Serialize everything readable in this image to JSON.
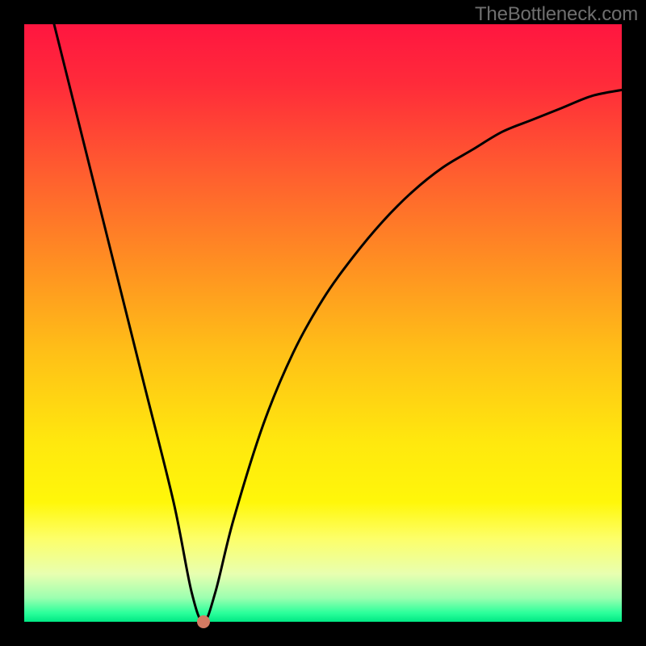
{
  "watermark": "TheBottleneck.com",
  "chart_data": {
    "type": "line",
    "title": "",
    "xlabel": "",
    "ylabel": "",
    "xlim": [
      0,
      100
    ],
    "ylim": [
      0,
      100
    ],
    "grid": false,
    "legend": false,
    "series": [
      {
        "name": "bottleneck-curve",
        "x": [
          5,
          10,
          15,
          20,
          25,
          28,
          30,
          32,
          35,
          40,
          45,
          50,
          55,
          60,
          65,
          70,
          75,
          80,
          85,
          90,
          95,
          100
        ],
        "y": [
          100,
          80,
          60,
          40,
          20,
          5,
          0,
          5,
          17,
          33,
          45,
          54,
          61,
          67,
          72,
          76,
          79,
          82,
          84,
          86,
          88,
          89
        ]
      }
    ],
    "marker": {
      "x": 30,
      "y": 0,
      "color": "#d47a62"
    },
    "background_gradient": {
      "type": "vertical",
      "stops": [
        {
          "pos": 0.0,
          "color": "#ff1640"
        },
        {
          "pos": 0.1,
          "color": "#ff2b3a"
        },
        {
          "pos": 0.25,
          "color": "#ff5e2f"
        },
        {
          "pos": 0.4,
          "color": "#ff8f22"
        },
        {
          "pos": 0.55,
          "color": "#ffc017"
        },
        {
          "pos": 0.7,
          "color": "#ffe80e"
        },
        {
          "pos": 0.8,
          "color": "#fff70a"
        },
        {
          "pos": 0.86,
          "color": "#fdff68"
        },
        {
          "pos": 0.92,
          "color": "#e8ffb0"
        },
        {
          "pos": 0.96,
          "color": "#9cffb0"
        },
        {
          "pos": 0.985,
          "color": "#2cff9b"
        },
        {
          "pos": 1.0,
          "color": "#00e884"
        }
      ]
    }
  }
}
